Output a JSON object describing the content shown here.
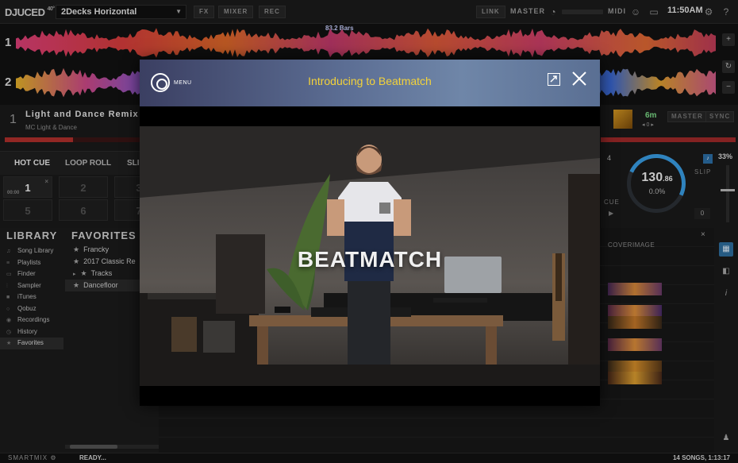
{
  "topbar": {
    "logo": "DJUCED",
    "logo_version": "40°",
    "layout_select": "2Decks Horizontal",
    "fx_label": "FX",
    "mixer_label": "MIXER",
    "rec_label": "REC",
    "link_label": "LINK",
    "master_label": "MASTER",
    "midi_label": "MIDI",
    "clock": "11:50AM"
  },
  "waveform": {
    "deck1_number": "1",
    "deck2_number": "2",
    "bars_label": "83.2 Bars"
  },
  "deck1": {
    "number": "1",
    "title": "Light and Dance Remix",
    "artist": "MC Light & Dance",
    "progress": 0.45,
    "tabs": [
      "HOT CUE",
      "LOOP ROLL",
      "SLI"
    ],
    "pads": [
      {
        "label": "1",
        "sub": "00:00",
        "set": true
      },
      {
        "label": "2",
        "set": false
      },
      {
        "label": "3",
        "set": false
      },
      {
        "label": "5",
        "set": false
      },
      {
        "label": "6",
        "set": false
      },
      {
        "label": "7",
        "set": false
      }
    ]
  },
  "deck2": {
    "time_remaining": "6m",
    "pitch_value": "0",
    "master_label": "MASTER",
    "sync_label": "SYNC",
    "deck_label": "4",
    "bpm_int": "130",
    "bpm_dec": ".86",
    "pitch_percent": "0.0%",
    "slip_label": "SLIP",
    "pitch_range": "33%",
    "cue_label": "CUE",
    "zero_box": "0"
  },
  "library": {
    "heading": "LIBRARY",
    "items": [
      {
        "icon": "note-icon",
        "label": "Song Library"
      },
      {
        "icon": "playlist-icon",
        "label": "Playlists"
      },
      {
        "icon": "folder-icon",
        "label": "Finder"
      },
      {
        "icon": "sampler-icon",
        "label": "Sampler"
      },
      {
        "icon": "itunes-icon",
        "label": "iTunes"
      },
      {
        "icon": "qobuz-icon",
        "label": "Qobuz"
      },
      {
        "icon": "mic-icon",
        "label": "Recordings"
      },
      {
        "icon": "clock-icon",
        "label": "History"
      },
      {
        "icon": "star-icon",
        "label": "Favorites"
      }
    ]
  },
  "favorites": {
    "heading": "FAVORITES",
    "items": [
      {
        "label": "Francky"
      },
      {
        "label": "2017 Classic Re"
      },
      {
        "label": "Tracks"
      },
      {
        "label": "Dancefloor"
      }
    ]
  },
  "tracklist": {
    "cover_header": "COVERIMAGE"
  },
  "modal": {
    "menu_label": "MENU",
    "title": "Introducing to Beatmatch",
    "video_caption": "BEATMATCH"
  },
  "statusbar": {
    "smartmix": "SMARTMIX",
    "status": "READY...",
    "songs": "14 SONGS, 1:13:17"
  },
  "colors": {
    "accent_blue": "#3aa0e8",
    "title_yellow": "#f3d23a",
    "deck_red": "#b3302d",
    "time_green": "#7ee08a"
  }
}
